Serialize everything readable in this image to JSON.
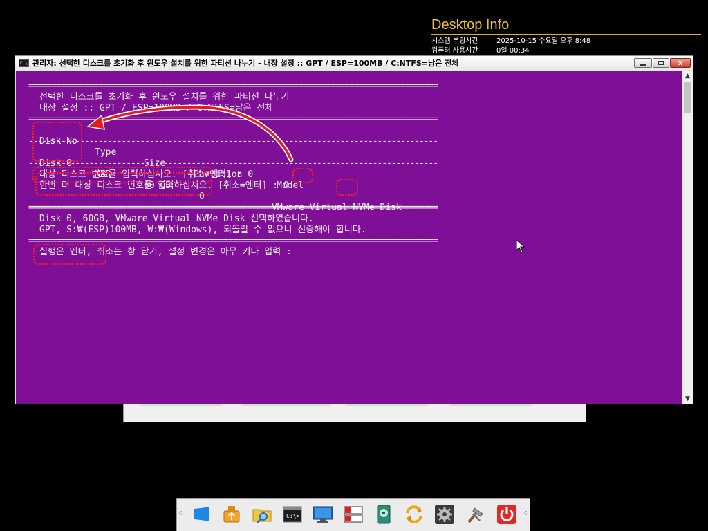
{
  "desktop_info": {
    "title": "Desktop Info",
    "rows": [
      {
        "label": "시스템 부팅시간",
        "value": "2025-10-15 수요일 오후 8:48"
      },
      {
        "label": "컴퓨터 사용시간",
        "value": "0일 00:34"
      }
    ]
  },
  "window": {
    "title": "관리자:  선택한 디스크를 초기화 후 윈도우 설치를 위한 파티션 나누기 - 내장 설정 :: GPT / ESP=100MB / C:NTFS=남은 전체",
    "icon_text": "C:\\",
    "close_glyph": "x"
  },
  "console": {
    "separator": "========================================================================================",
    "dash_separator": "----------------------------------------------------------------------------------------",
    "header_line1": "선택한 디스크를 초기화 후 윈도우 설치를 위한 파티션 나누기",
    "header_line2": "내장 설정 :: GPT / ESP=100MB / C:NTFS=남은 전체",
    "columns": [
      "Disk No",
      "Type",
      "Size",
      "Partition",
      "Model"
    ],
    "disks": [
      {
        "disk_no": "Disk 0",
        "type": "MBR",
        "size": "60 GB",
        "partition": "0",
        "model": "VMware Virtual NVMe Disk"
      }
    ],
    "prompt1": "대상 디스크 번호를 입력하십시오. [취소=엔터] : 0",
    "prompt2": "한번 더 대상 디스크 번호를 입력하십시오. [취소=엔터] : 0",
    "selected_line": "Disk 0, 60GB, VMware Virtual NVMe Disk 선택하였습니다.",
    "warning_line": "GPT, S:₩(ESP)100MB, W:₩(Windows), 되돌릴 수 없으니 신중해야 합니다.",
    "final_prompt": "실행은 엔터, 취소는 창 닫기, 설정 변경은 아무 키나 입력 :"
  },
  "taskbar": {
    "icons": [
      "windows-start-icon",
      "usb-drive-icon",
      "folder-search-icon",
      "command-prompt-icon",
      "monitor-icon",
      "disk-partition-icon",
      "disk-check-icon",
      "sync-refresh-icon",
      "gear-icon",
      "tools-hammer-icon",
      "power-icon"
    ]
  },
  "colors": {
    "console_background": "#800f98",
    "console_text": "#f4f0f4",
    "highlight": "#ff2020",
    "desktop_info_title": "#f0c030"
  }
}
